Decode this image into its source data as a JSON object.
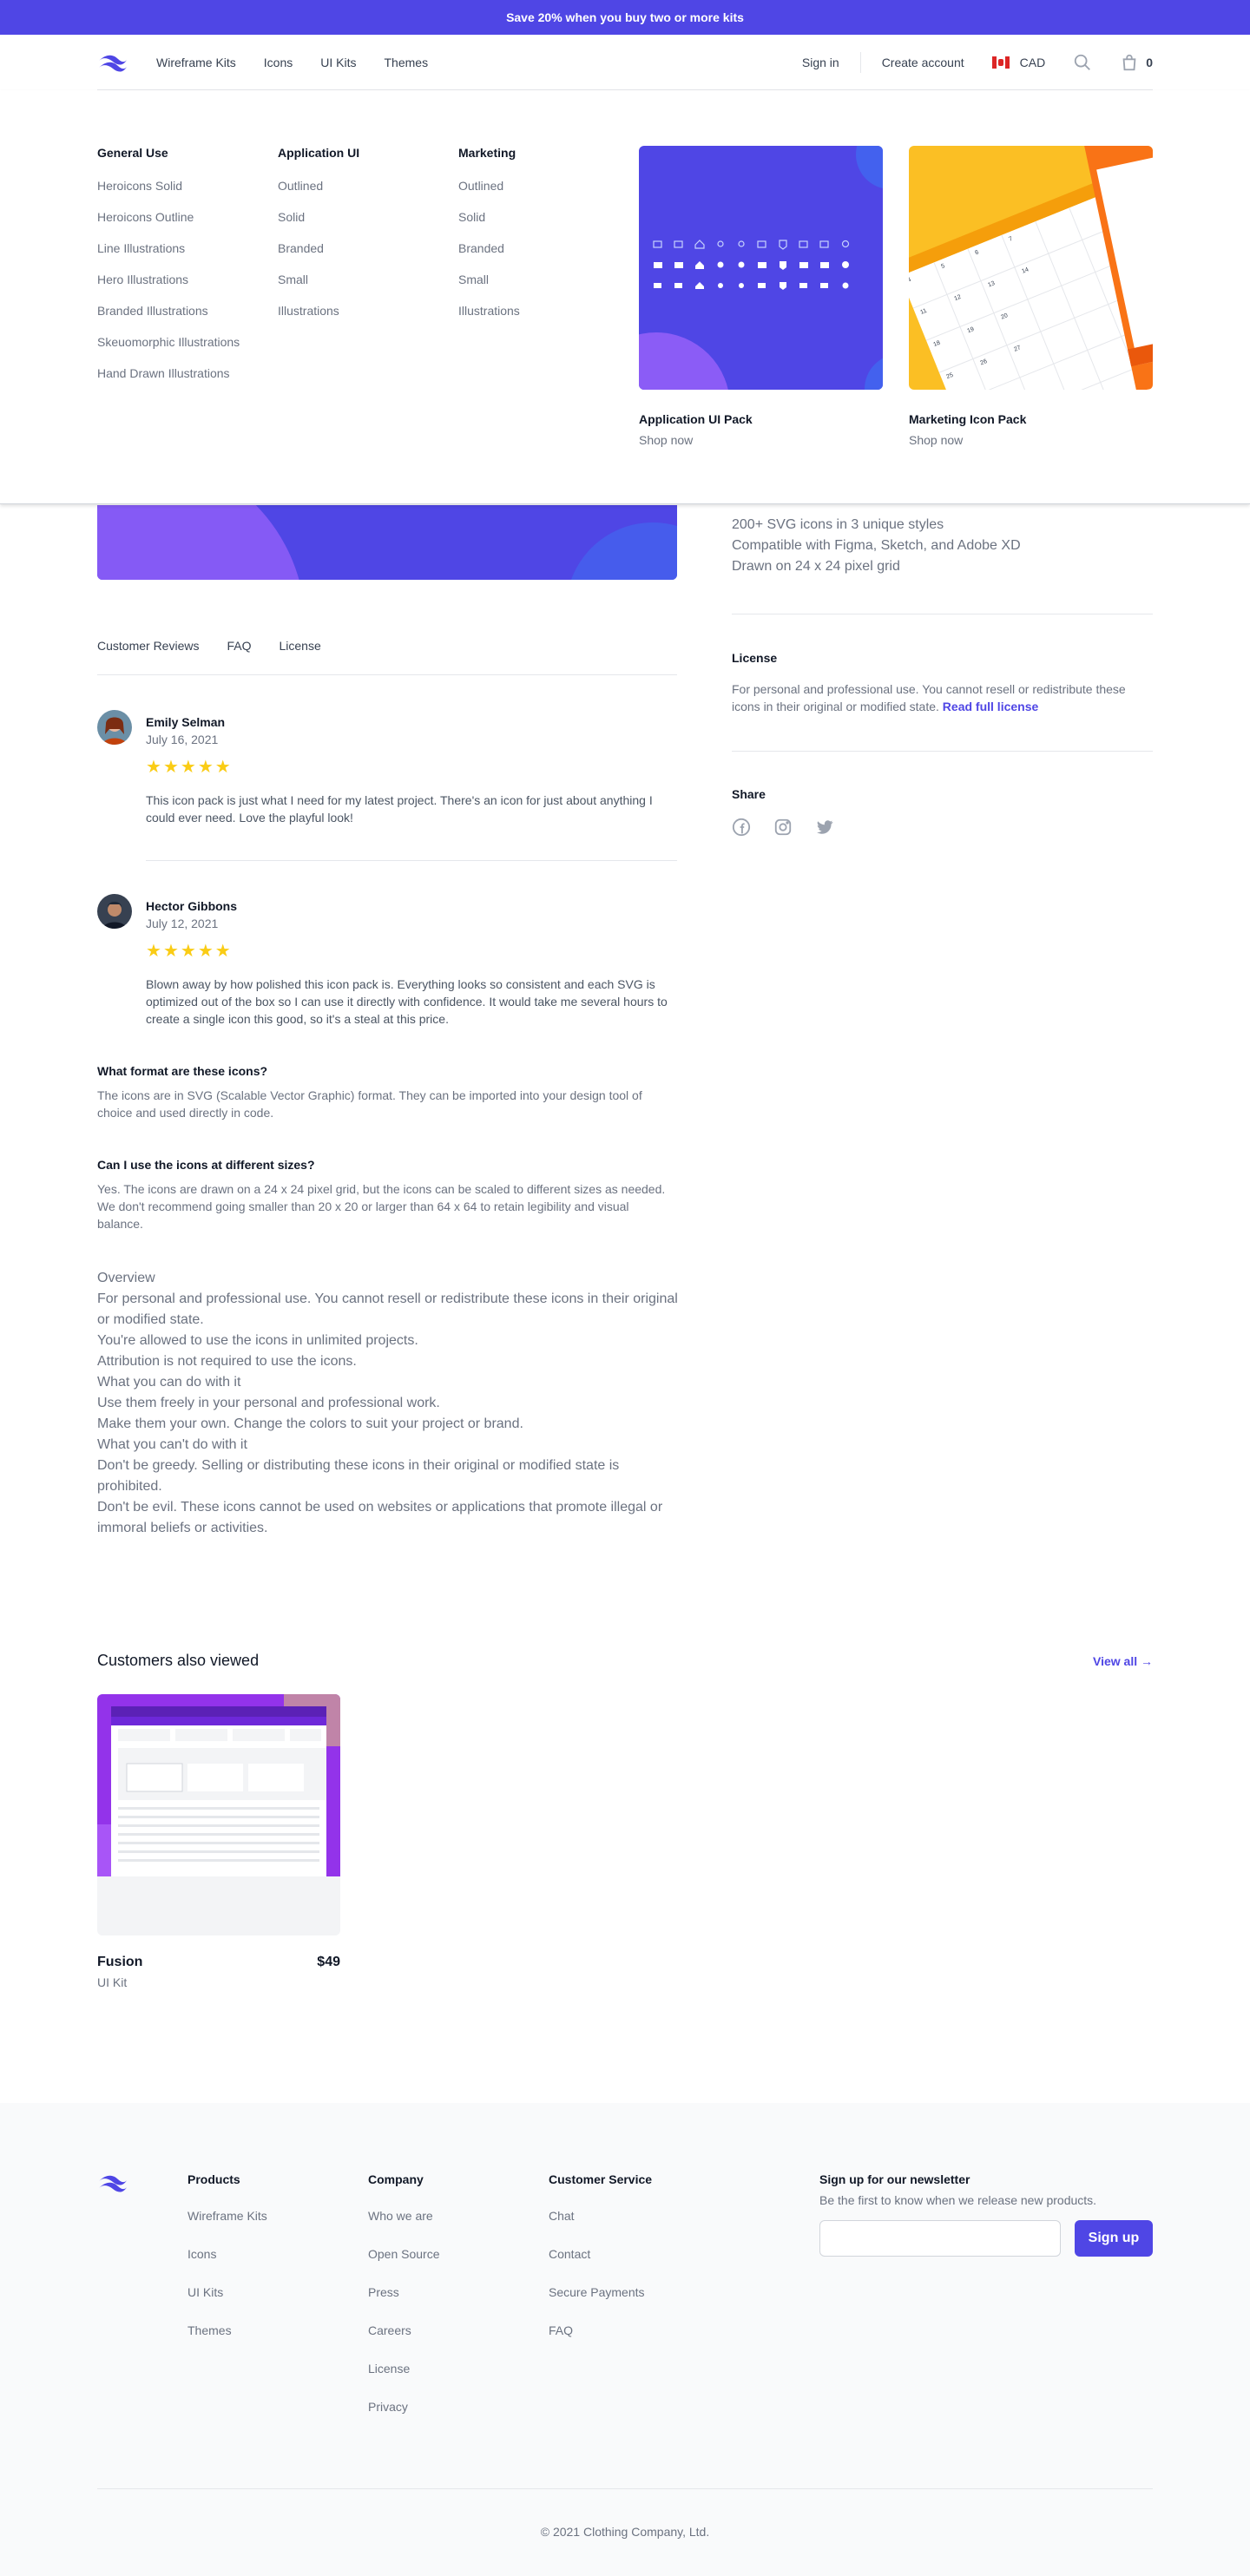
{
  "promo": {
    "text": "Save 20% when you buy two or more kits"
  },
  "nav": {
    "links": [
      "Wireframe Kits",
      "Icons",
      "UI Kits",
      "Themes"
    ],
    "sign_in": "Sign in",
    "create_account": "Create account",
    "currency": "CAD",
    "cart_count": "0"
  },
  "mega_menu": {
    "columns": [
      {
        "heading": "General Use",
        "items": [
          "Heroicons Solid",
          "Heroicons Outline",
          "Line Illustrations",
          "Hero Illustrations",
          "Branded Illustrations",
          "Skeuomorphic Illustrations",
          "Hand Drawn Illustrations"
        ]
      },
      {
        "heading": "Application UI",
        "items": [
          "Outlined",
          "Solid",
          "Branded",
          "Small",
          "Illustrations"
        ]
      },
      {
        "heading": "Marketing",
        "items": [
          "Outlined",
          "Solid",
          "Branded",
          "Small",
          "Illustrations"
        ]
      }
    ],
    "features": [
      {
        "title": "Application UI Pack",
        "cta": "Shop now"
      },
      {
        "title": "Marketing Icon Pack",
        "cta": "Shop now"
      }
    ]
  },
  "highlights": [
    "200+ SVG icons in 3 unique styles",
    "Compatible with Figma, Sketch, and Adobe XD",
    "Drawn on 24 x 24 pixel grid"
  ],
  "license": {
    "heading": "License",
    "summary": "For personal and professional use. You cannot resell or redistribute these icons in their original or modified state.",
    "link": "Read full license"
  },
  "share": {
    "heading": "Share"
  },
  "tabs": [
    "Customer Reviews",
    "FAQ",
    "License"
  ],
  "reviews": [
    {
      "name": "Emily Selman",
      "date": "July 16, 2021",
      "rating": 5,
      "body": "This icon pack is just what I need for my latest project. There's an icon for just about anything I could ever need. Love the playful look!"
    },
    {
      "name": "Hector Gibbons",
      "date": "July 12, 2021",
      "rating": 5,
      "body": "Blown away by how polished this icon pack is. Everything looks so consistent and each SVG is optimized out of the box so I can use it directly with confidence. It would take me several hours to create a single icon this good, so it's a steal at this price."
    }
  ],
  "faq": [
    {
      "q": "What format are these icons?",
      "a": "The icons are in SVG (Scalable Vector Graphic) format. They can be imported into your design tool of choice and used directly in code."
    },
    {
      "q": "Can I use the icons at different sizes?",
      "a": "Yes. The icons are drawn on a 24 x 24 pixel grid, but the icons can be scaled to different sizes as needed. We don't recommend going smaller than 20 x 20 or larger than 64 x 64 to retain legibility and visual balance."
    }
  ],
  "overview": [
    "Overview",
    "For personal and professional use. You cannot resell or redistribute these icons in their original or modified state.",
    "You're allowed to use the icons in unlimited projects.",
    "Attribution is not required to use the icons.",
    "What you can do with it",
    "Use them freely in your personal and professional work.",
    "Make them your own. Change the colors to suit your project or brand.",
    "What you can't do with it",
    "Don't be greedy. Selling or distributing these icons in their original or modified state is prohibited.",
    "Don't be evil. These icons cannot be used on websites or applications that promote illegal or immoral beliefs or activities."
  ],
  "also_viewed": {
    "title": "Customers also viewed",
    "view_all": "View all →",
    "products": [
      {
        "name": "Fusion",
        "price": "$49",
        "category": "UI Kit"
      }
    ]
  },
  "footer": {
    "columns": [
      {
        "heading": "Products",
        "items": [
          "Wireframe Kits",
          "Icons",
          "UI Kits",
          "Themes"
        ]
      },
      {
        "heading": "Company",
        "items": [
          "Who we are",
          "Open Source",
          "Press",
          "Careers",
          "License",
          "Privacy"
        ]
      },
      {
        "heading": "Customer Service",
        "items": [
          "Chat",
          "Contact",
          "Secure Payments",
          "FAQ"
        ]
      }
    ],
    "newsletter": {
      "heading": "Sign up for our newsletter",
      "text": "Be the first to know when we release new products.",
      "placeholder": "",
      "button": "Sign up"
    },
    "copyright": "© 2021 Clothing Company, Ltd."
  },
  "colors": {
    "accent": "#4f46e5",
    "star": "#facc15",
    "marketing_pack": "#fbbf24"
  }
}
